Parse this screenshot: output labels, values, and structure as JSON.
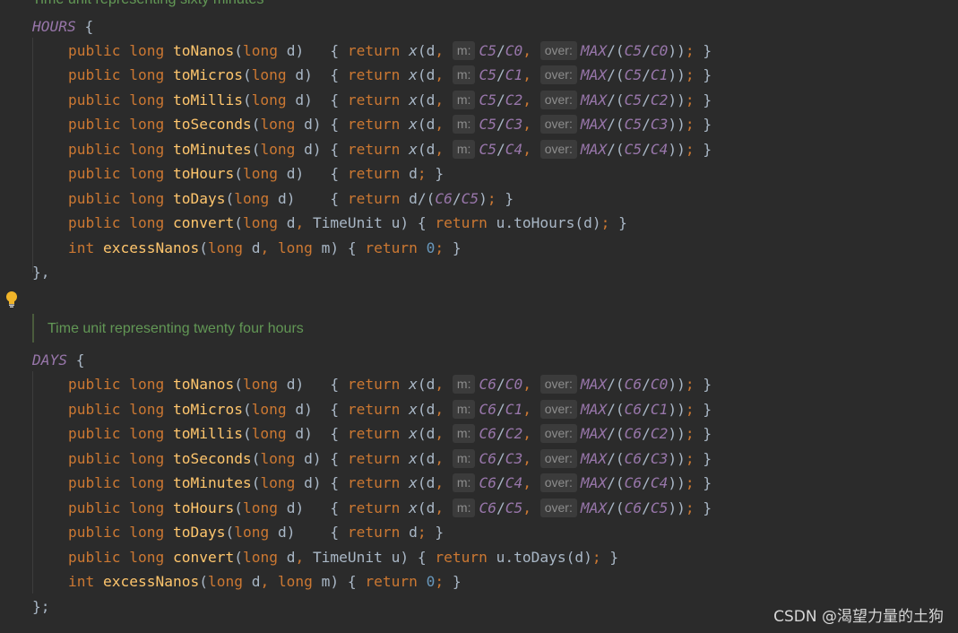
{
  "top_text": "Time unit representing sixty minutes",
  "doc_comment": "Time unit representing twenty four hours",
  "watermark": "CSDN @渴望力量的土狗",
  "icons": {
    "bulb": "lightbulb-intention-icon"
  },
  "colors": {
    "keyword": "#cc7832",
    "function": "#ffc66d",
    "constant": "#9876aa",
    "number": "#6897bb",
    "text": "#a9b7c6",
    "comment": "#629755",
    "background": "#2b2b2b"
  },
  "code": {
    "kw_public": "public",
    "kw_long": "long",
    "kw_int": "int",
    "kw_return": "return",
    "param_d": "d",
    "param_u": "u",
    "param_m": "m",
    "fn_toNanos": "toNanos",
    "fn_toMicros": "toMicros",
    "fn_toMillis": "toMillis",
    "fn_toSeconds": "toSeconds",
    "fn_toMinutes": "toMinutes",
    "fn_toHours": "toHours",
    "fn_toDays": "toDays",
    "fn_convert": "convert",
    "fn_excessNanos": "excessNanos",
    "fn_x": "x",
    "type_TimeUnit": "TimeUnit",
    "const_HOURS": "HOURS",
    "const_DAYS": "DAYS",
    "const_MAX": "MAX",
    "const_C0": "C0",
    "const_C1": "C1",
    "const_C2": "C2",
    "const_C3": "C3",
    "const_C4": "C4",
    "const_C5": "C5",
    "const_C6": "C6",
    "hint_m": "m:",
    "hint_over": "over:",
    "zero": "0",
    "call_toHours": "u.toHours(d)",
    "call_toDays": "u.toDays(d)",
    "enum_close_comma": "},",
    "enum_close_semi": "};"
  }
}
